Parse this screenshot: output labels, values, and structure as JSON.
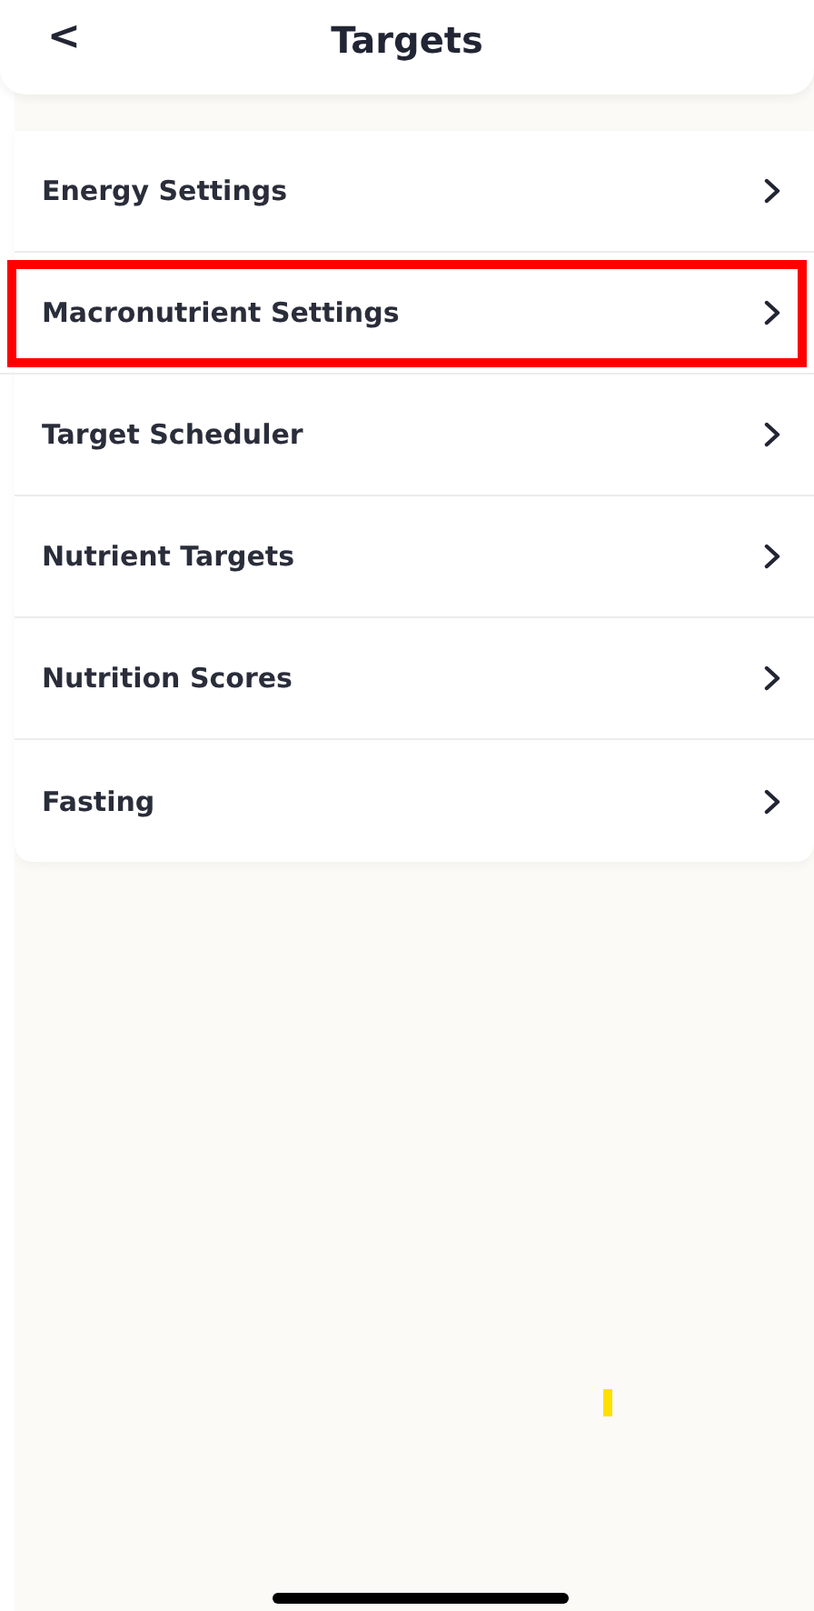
{
  "header": {
    "back": "<",
    "title": "Targets"
  },
  "items": [
    {
      "label": "Energy Settings",
      "highlighted": false
    },
    {
      "label": "Macronutrient Settings",
      "highlighted": true
    },
    {
      "label": "Target Scheduler",
      "highlighted": false
    },
    {
      "label": "Nutrient Targets",
      "highlighted": false
    },
    {
      "label": "Nutrition Scores",
      "highlighted": false
    },
    {
      "label": "Fasting",
      "highlighted": false
    }
  ]
}
